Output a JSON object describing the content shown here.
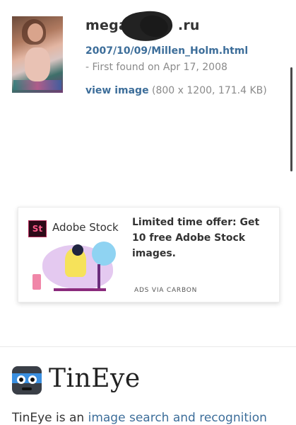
{
  "result": {
    "domain": "megaru.ru",
    "domain_visible_prefix": "mega",
    "domain_visible_suffix": ".ru",
    "url": "2007/10/09/Millen_Holm.html",
    "first_found": "- First found on Apr 17, 2008",
    "view_link": "view image",
    "image_meta": "(800 x 1200, 171.4 KB)"
  },
  "ad": {
    "brand_badge": "St",
    "brand_name": "Adobe Stock",
    "headline": "Limited time offer: Get 10 free Adobe Stock images.",
    "via": "ADS VIA CARBON"
  },
  "footer": {
    "brand": "TinEye",
    "about_prefix": "TinEye is an ",
    "about_link": "image search and recognition"
  },
  "colors": {
    "link": "#3d6e9a",
    "muted": "#8a8a8a",
    "text": "#333333"
  }
}
